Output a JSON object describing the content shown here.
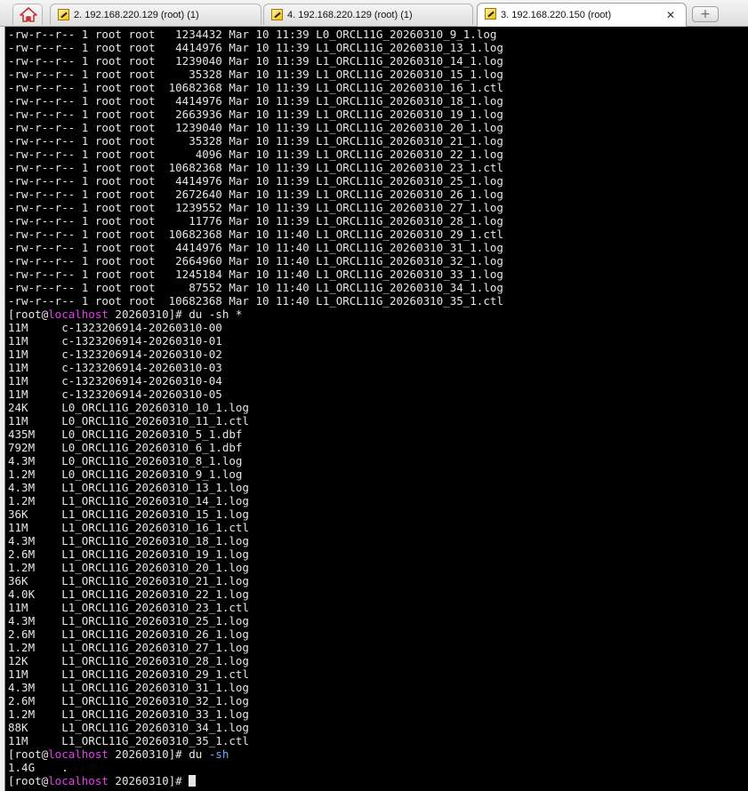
{
  "tabs": [
    {
      "label": "2. 192.168.220.129 (root) (1)",
      "active": false
    },
    {
      "label": "4. 192.168.220.129 (root) (1)",
      "active": false
    },
    {
      "label": "3. 192.168.220.150 (root)",
      "active": true
    }
  ],
  "close_glyph": "✕",
  "new_tab_glyph": "+",
  "prompt": {
    "user": "[root@",
    "host": "localhost",
    "dir": " 20260310]# "
  },
  "commands": {
    "du_star": "du -sh *",
    "du_cmd": "du ",
    "du_flag": "-sh"
  },
  "ls_lines": [
    "-rw-r--r-- 1 root root   1234432 Mar 10 11:39 L0_ORCL11G_20260310_9_1.log",
    "-rw-r--r-- 1 root root   4414976 Mar 10 11:39 L1_ORCL11G_20260310_13_1.log",
    "-rw-r--r-- 1 root root   1239040 Mar 10 11:39 L1_ORCL11G_20260310_14_1.log",
    "-rw-r--r-- 1 root root     35328 Mar 10 11:39 L1_ORCL11G_20260310_15_1.log",
    "-rw-r--r-- 1 root root  10682368 Mar 10 11:39 L1_ORCL11G_20260310_16_1.ctl",
    "-rw-r--r-- 1 root root   4414976 Mar 10 11:39 L1_ORCL11G_20260310_18_1.log",
    "-rw-r--r-- 1 root root   2663936 Mar 10 11:39 L1_ORCL11G_20260310_19_1.log",
    "-rw-r--r-- 1 root root   1239040 Mar 10 11:39 L1_ORCL11G_20260310_20_1.log",
    "-rw-r--r-- 1 root root     35328 Mar 10 11:39 L1_ORCL11G_20260310_21_1.log",
    "-rw-r--r-- 1 root root      4096 Mar 10 11:39 L1_ORCL11G_20260310_22_1.log",
    "-rw-r--r-- 1 root root  10682368 Mar 10 11:39 L1_ORCL11G_20260310_23_1.ctl",
    "-rw-r--r-- 1 root root   4414976 Mar 10 11:39 L1_ORCL11G_20260310_25_1.log",
    "-rw-r--r-- 1 root root   2672640 Mar 10 11:39 L1_ORCL11G_20260310_26_1.log",
    "-rw-r--r-- 1 root root   1239552 Mar 10 11:39 L1_ORCL11G_20260310_27_1.log",
    "-rw-r--r-- 1 root root     11776 Mar 10 11:39 L1_ORCL11G_20260310_28_1.log",
    "-rw-r--r-- 1 root root  10682368 Mar 10 11:40 L1_ORCL11G_20260310_29_1.ctl",
    "-rw-r--r-- 1 root root   4414976 Mar 10 11:40 L1_ORCL11G_20260310_31_1.log",
    "-rw-r--r-- 1 root root   2664960 Mar 10 11:40 L1_ORCL11G_20260310_32_1.log",
    "-rw-r--r-- 1 root root   1245184 Mar 10 11:40 L1_ORCL11G_20260310_33_1.log",
    "-rw-r--r-- 1 root root     87552 Mar 10 11:40 L1_ORCL11G_20260310_34_1.log",
    "-rw-r--r-- 1 root root  10682368 Mar 10 11:40 L1_ORCL11G_20260310_35_1.ctl"
  ],
  "du_lines": [
    "11M     c-1323206914-20260310-00",
    "11M     c-1323206914-20260310-01",
    "11M     c-1323206914-20260310-02",
    "11M     c-1323206914-20260310-03",
    "11M     c-1323206914-20260310-04",
    "11M     c-1323206914-20260310-05",
    "24K     L0_ORCL11G_20260310_10_1.log",
    "11M     L0_ORCL11G_20260310_11_1.ctl",
    "435M    L0_ORCL11G_20260310_5_1.dbf",
    "792M    L0_ORCL11G_20260310_6_1.dbf",
    "4.3M    L0_ORCL11G_20260310_8_1.log",
    "1.2M    L0_ORCL11G_20260310_9_1.log",
    "4.3M    L1_ORCL11G_20260310_13_1.log",
    "1.2M    L1_ORCL11G_20260310_14_1.log",
    "36K     L1_ORCL11G_20260310_15_1.log",
    "11M     L1_ORCL11G_20260310_16_1.ctl",
    "4.3M    L1_ORCL11G_20260310_18_1.log",
    "2.6M    L1_ORCL11G_20260310_19_1.log",
    "1.2M    L1_ORCL11G_20260310_20_1.log",
    "36K     L1_ORCL11G_20260310_21_1.log",
    "4.0K    L1_ORCL11G_20260310_22_1.log",
    "11M     L1_ORCL11G_20260310_23_1.ctl",
    "4.3M    L1_ORCL11G_20260310_25_1.log",
    "2.6M    L1_ORCL11G_20260310_26_1.log",
    "1.2M    L1_ORCL11G_20260310_27_1.log",
    "12K     L1_ORCL11G_20260310_28_1.log",
    "11M     L1_ORCL11G_20260310_29_1.ctl",
    "4.3M    L1_ORCL11G_20260310_31_1.log",
    "2.6M    L1_ORCL11G_20260310_32_1.log",
    "1.2M    L1_ORCL11G_20260310_33_1.log",
    "88K     L1_ORCL11G_20260310_34_1.log",
    "11M     L1_ORCL11G_20260310_35_1.ctl"
  ],
  "du_total": "1.4G    .",
  "colors": {
    "host": "#e93cf0",
    "flag": "#6fa7ff",
    "background": "#000000",
    "foreground": "#e6e6e6"
  }
}
